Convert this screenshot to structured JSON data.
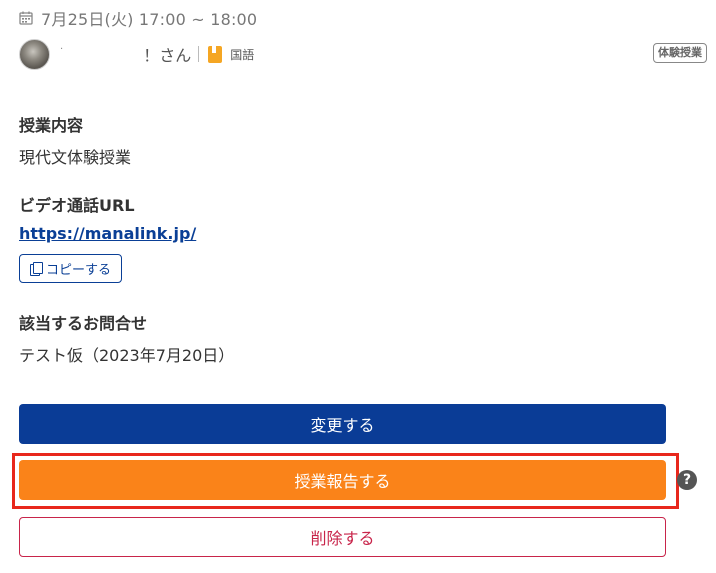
{
  "lesson": {
    "datetime": "7月25日(火) 17:00 ~ 18:00",
    "user_dot": "·",
    "user_name": "！さん",
    "subject": "国語",
    "badge": "体験授業"
  },
  "sections": {
    "content_label": "授業内容",
    "content_value": "現代文体験授業",
    "video_label": "ビデオ通話URL",
    "video_url": "https://manalink.jp/",
    "copy_label": "コピーする",
    "inquiry_label": "該当するお問合せ",
    "inquiry_value": "テスト仮（2023年7月20日）"
  },
  "actions": {
    "change_label": "変更する",
    "report_label": "授業報告する",
    "delete_label": "削除する",
    "help_glyph": "?"
  },
  "colors": {
    "primary": "#0a3c96",
    "report": "#fa8319",
    "danger": "#c8244a",
    "highlight": "#e8271c",
    "subject_icon": "#f5a623"
  },
  "icons": {
    "calendar": "calendar-icon",
    "subject": "subject-book-icon",
    "copy": "copy-icon",
    "help": "help-icon"
  }
}
